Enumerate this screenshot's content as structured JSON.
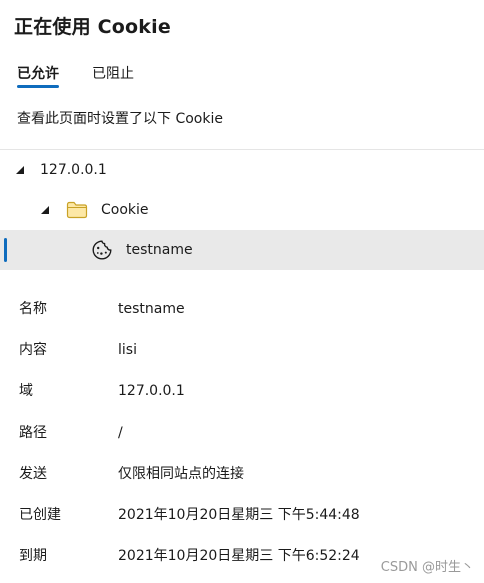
{
  "header": {
    "title": "正在使用 Cookie"
  },
  "tabs": [
    {
      "label": "已允许",
      "active": true
    },
    {
      "label": "已阻止",
      "active": false
    }
  ],
  "description": "查看此页面时设置了以下 Cookie",
  "tree": {
    "host": {
      "label": "127.0.0.1",
      "expanded": true
    },
    "folder": {
      "label": "Cookie",
      "expanded": true,
      "icon": "folder-icon"
    },
    "cookie": {
      "label": "testname",
      "icon": "cookie-icon",
      "selected": true
    }
  },
  "details": [
    {
      "key": "名称",
      "value": "testname"
    },
    {
      "key": "内容",
      "value": "lisi"
    },
    {
      "key": "域",
      "value": "127.0.0.1"
    },
    {
      "key": "路径",
      "value": "/"
    },
    {
      "key": "发送",
      "value": "仅限相同站点的连接"
    },
    {
      "key": "已创建",
      "value": "2021年10月20日星期三 下午5:44:48"
    },
    {
      "key": "到期",
      "value": "2021年10月20日星期三 下午6:52:24"
    }
  ],
  "watermark": "CSDN @时生丶",
  "colors": {
    "accent": "#0f6cbd",
    "selected_row": "#e9e9e9",
    "folder": "#f4c542"
  }
}
